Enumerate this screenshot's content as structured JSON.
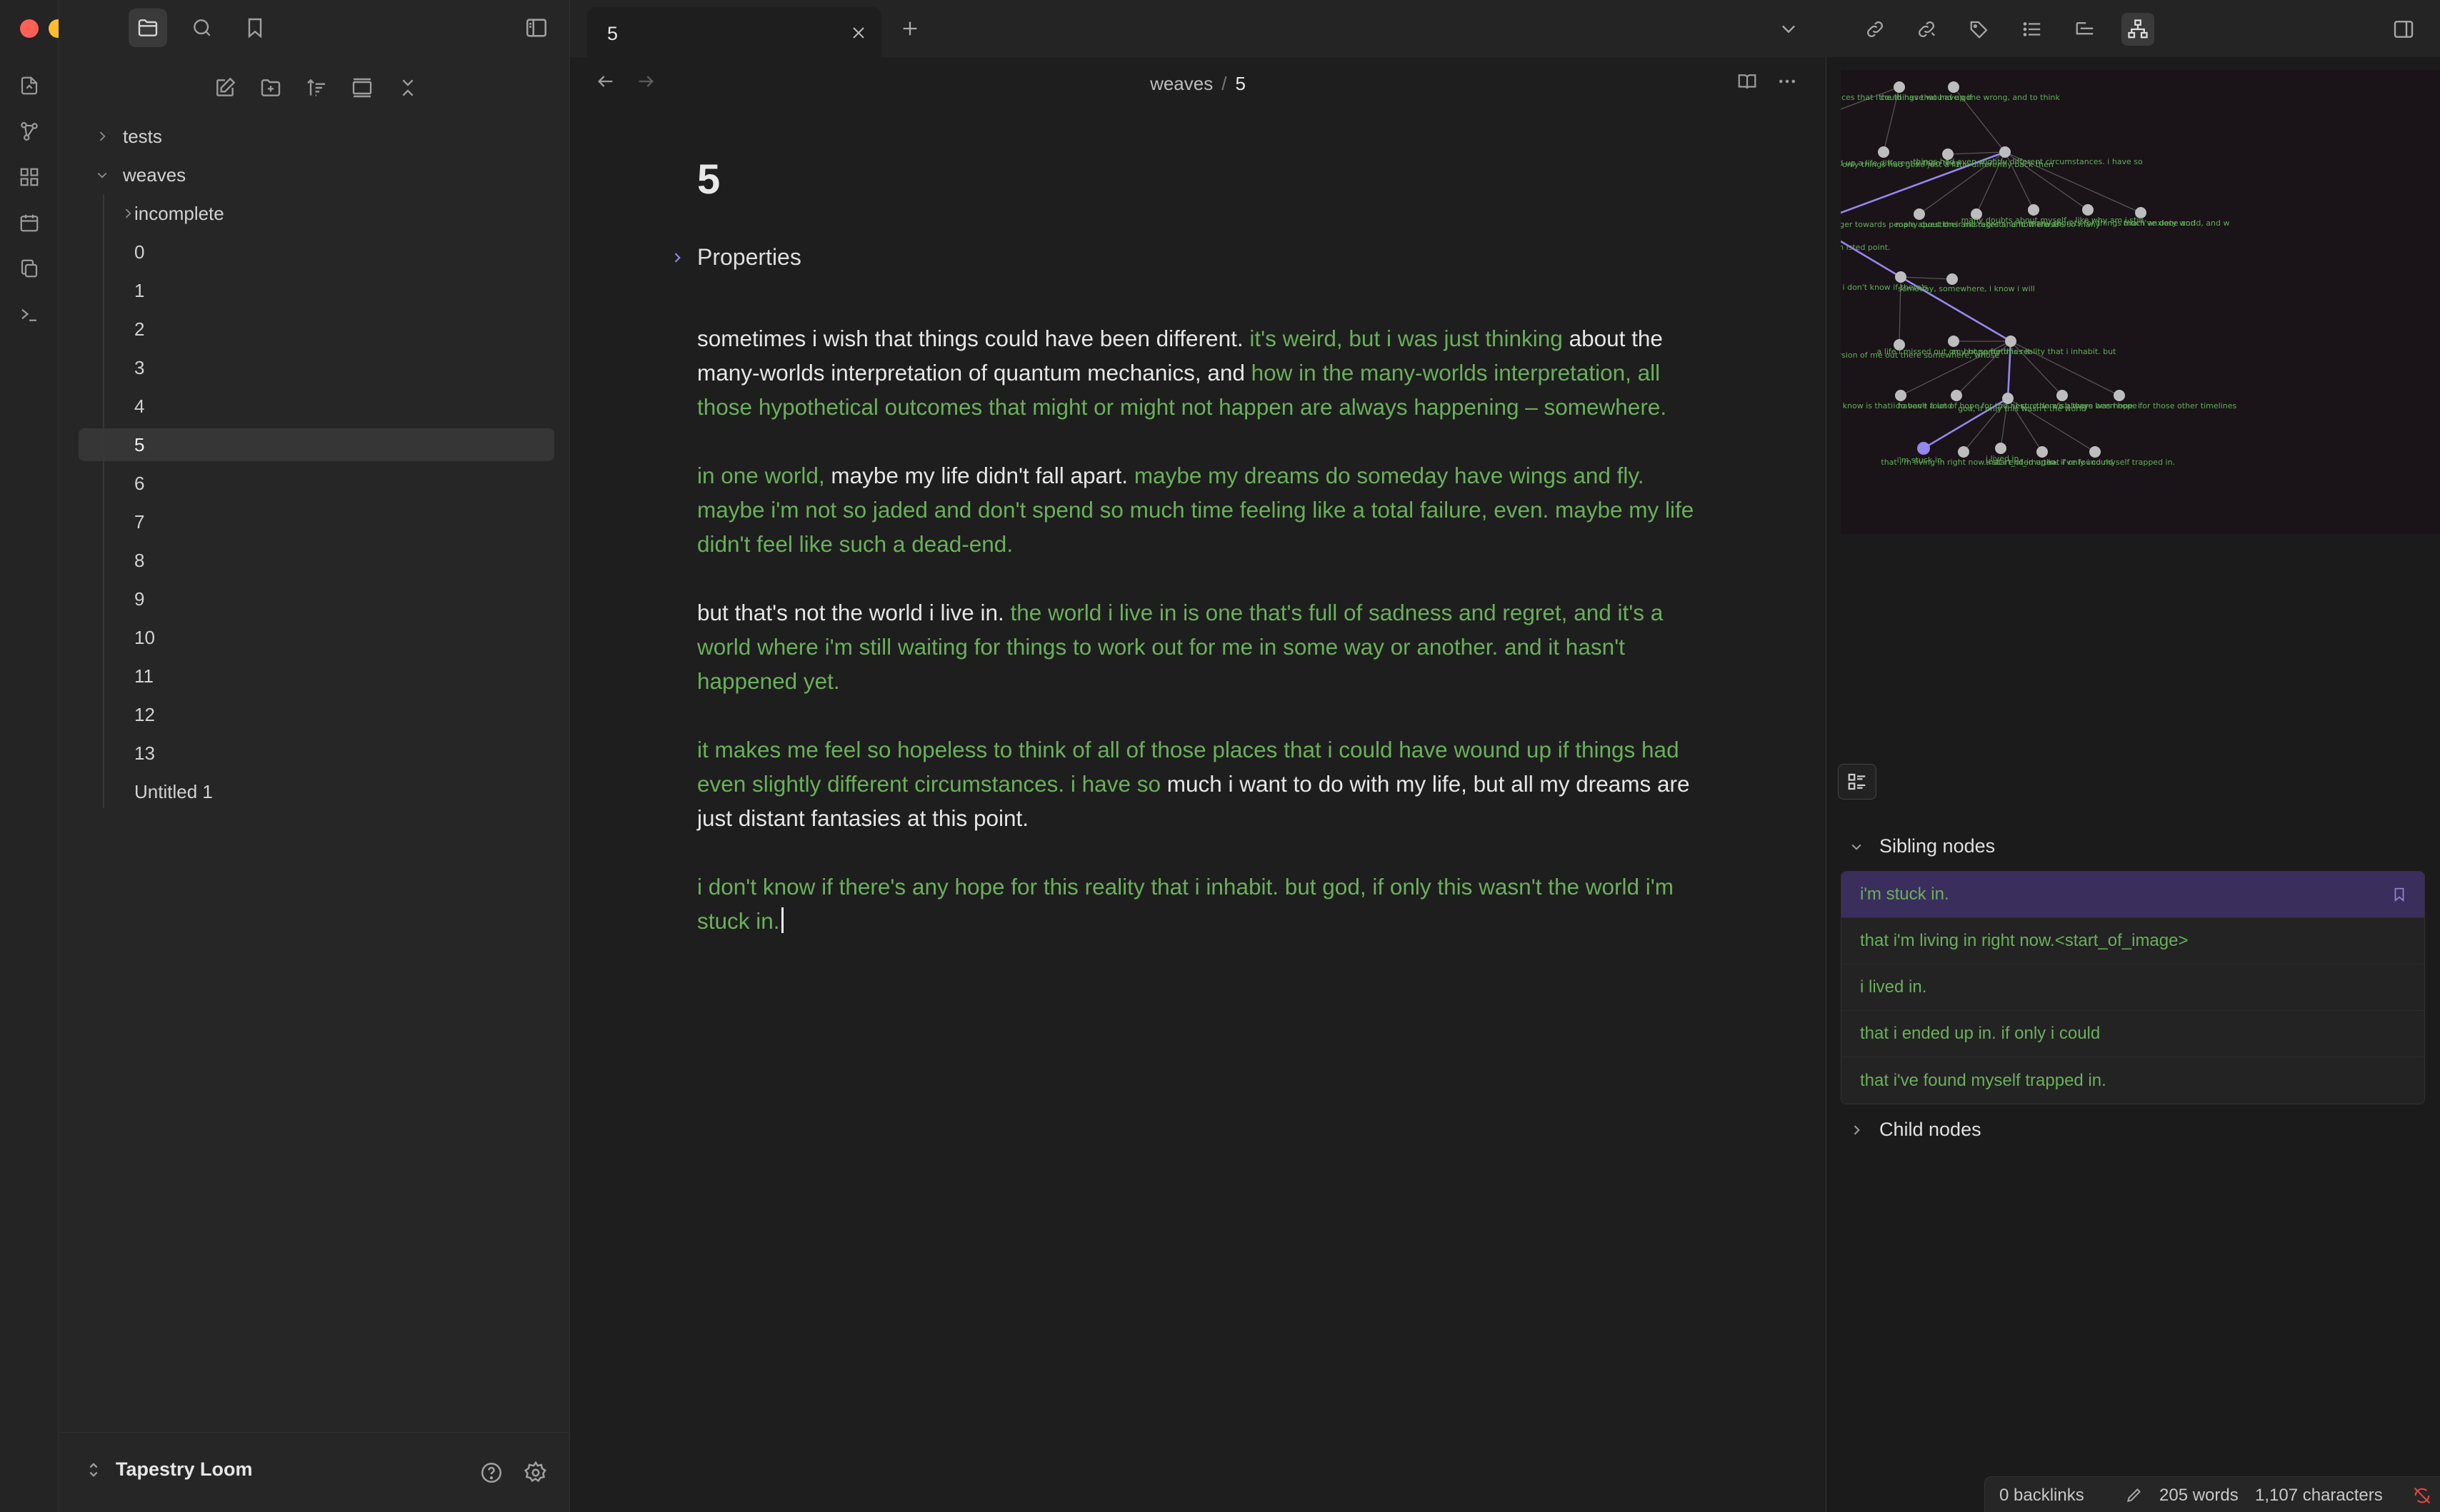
{
  "window": {
    "traffic_colors": {
      "close": "#fe5f57",
      "minimize": "#febc2e",
      "maximize": "#28c840"
    }
  },
  "ribbon": [
    "open-quick-switcher",
    "open-graph-view",
    "open-canvas",
    "open-daily-note",
    "open-templates",
    "open-command-palette"
  ],
  "file_tree": {
    "items": [
      {
        "label": "tests",
        "type": "folder",
        "expanded": false
      },
      {
        "label": "weaves",
        "type": "folder",
        "expanded": true
      },
      {
        "label": "incomplete",
        "type": "folder",
        "expanded": false
      },
      {
        "label": "0"
      },
      {
        "label": "1"
      },
      {
        "label": "2"
      },
      {
        "label": "3"
      },
      {
        "label": "4"
      },
      {
        "label": "5",
        "active": true
      },
      {
        "label": "6"
      },
      {
        "label": "7"
      },
      {
        "label": "8"
      },
      {
        "label": "9"
      },
      {
        "label": "10"
      },
      {
        "label": "11"
      },
      {
        "label": "12"
      },
      {
        "label": "13"
      },
      {
        "label": "Untitled 1"
      }
    ]
  },
  "vault": {
    "name": "Tapestry Loom"
  },
  "tab": {
    "title": "5"
  },
  "breadcrumb": {
    "folder": "weaves",
    "separator": "/",
    "current": "5"
  },
  "note": {
    "title": "5",
    "properties_label": "Properties",
    "paragraphs": [
      [
        {
          "t": "sometimes i wish that things could have been different.",
          "c": "w"
        },
        {
          "t": " it's weird, but i was just thinking",
          "c": "g"
        },
        {
          "t": " about the many-worlds interpretation of quantum mechanics, and",
          "c": "w"
        },
        {
          "t": " how in the many-worlds interpretation, all those",
          "c": "g"
        },
        {
          "t": " hypothetical outcomes that might or might not happen are always happening – somewhere.",
          "c": "g"
        }
      ],
      [
        {
          "t": "in one world, ",
          "c": "g"
        },
        {
          "t": "maybe my life didn't fall apart.",
          "c": "w"
        },
        {
          "t": " maybe my dreams do someday have wings and fly.",
          "c": "g"
        },
        {
          "t": " maybe i'm not so jaded and don",
          "c": "g"
        },
        {
          "t": "'t spend so much time feeling",
          "c": "g"
        },
        {
          "t": " like a total failure,",
          "c": "g"
        },
        {
          "t": " even. maybe my life didn't feel like",
          "c": "g"
        },
        {
          "t": " such a dead-end.",
          "c": "g"
        }
      ],
      [
        {
          "t": "but that's not the world i live in.",
          "c": "w"
        },
        {
          "t": " the world i live in is one that's",
          "c": "g"
        },
        {
          "t": " full of sadness and regret, and it's",
          "c": "g"
        },
        {
          "t": " a world where i'm still waiting for things",
          "c": "g"
        },
        {
          "t": " to work out for me in some way or another",
          "c": "g"
        },
        {
          "t": ". and it hasn't happened yet.",
          "c": "g"
        }
      ],
      [
        {
          "t": "it makes me feel so hopeless to think of all",
          "c": "g"
        },
        {
          "t": " of those places that i could have wound up if",
          "c": "g"
        },
        {
          "t": " things had even slightly different circumstances. i have so",
          "c": "g"
        },
        {
          "t": " much i want to do with my life, but all my dreams are just distant fantasies at this point.",
          "c": "w"
        }
      ],
      [
        {
          "t": "i don't know if there's",
          "c": "g"
        },
        {
          "t": " any hope for this reality that i inhabit. but",
          "c": "g"
        },
        {
          "t": " god, if only this wasn't the world",
          "c": "g"
        },
        {
          "t": " i'm stuck in.",
          "c": "g"
        }
      ]
    ]
  },
  "graph": {
    "labels": [
      "of those places that i could have wound up if",
      "the things that have gone wrong, and to think",
      "i had just wound up a life differently than they",
      "only things had gone just a little differently back then",
      "things had even slightly different circumstances. i have so",
      "much anger towards people about their mistakes and how those",
      "many questions and regrets, and there are so many",
      "many doubts about myself – like why am i still",
      "many regrets for things that i've done and",
      "much anxiety world, and w",
      "o with isted point.",
      "i don't know if there's",
      "someday, somewhere, i know i will",
      "actually another version of me out there somewhere, whose",
      "a life i missed out on, but sometimes it",
      "any hope for this reality that i inhabit. but",
      "all i know is that i haven't found",
      "i do have a lot of hope for the next",
      "god, if only this wasn't the world",
      "i sure do wish there was hope. i",
      "there's always been hope for those other timelines",
      "i'm stuck in.",
      "that i'm living in right now.<start_of_image>",
      "i lived in.",
      "that i ended up in. if only i could",
      "that i've found myself trapped in."
    ]
  },
  "sidebar": {
    "sibling_header": "Sibling nodes",
    "siblings": [
      {
        "label": "i'm stuck in.",
        "active": true
      },
      {
        "label": "that i'm living in right now.<start_of_image>"
      },
      {
        "label": "i lived in."
      },
      {
        "label": "that i ended up in. if only i could"
      },
      {
        "label": "that i've found myself trapped in."
      }
    ],
    "child_header": "Child nodes"
  },
  "status": {
    "backlinks": "0 backlinks",
    "words": "205 words",
    "characters": "1,107 characters"
  },
  "colors": {
    "accent": "#8b7cf0",
    "generated_text": "#6ab05a",
    "active_node_bg": "#3a2f5c"
  }
}
